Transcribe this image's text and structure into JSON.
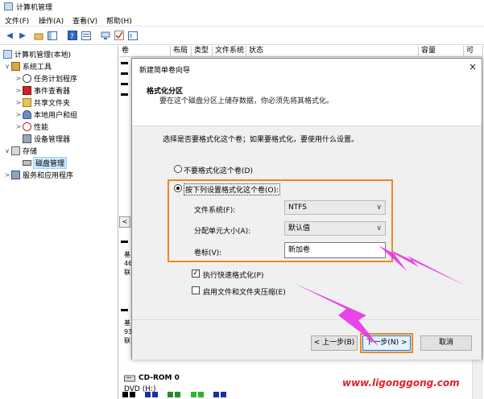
{
  "window": {
    "title": "计算机管理"
  },
  "menu": [
    "文件(F)",
    "操作(A)",
    "查看(V)",
    "帮助(H)"
  ],
  "tree": [
    {
      "label": "计算机管理(本地)",
      "level": 0,
      "arrow": ""
    },
    {
      "label": "系统工具",
      "level": 1,
      "arrow": "∨"
    },
    {
      "label": "任务计划程序",
      "level": 2,
      "arrow": ">"
    },
    {
      "label": "事件查看器",
      "level": 2,
      "arrow": ">"
    },
    {
      "label": "共享文件夹",
      "level": 2,
      "arrow": ">"
    },
    {
      "label": "本地用户和组",
      "level": 2,
      "arrow": ">"
    },
    {
      "label": "性能",
      "level": 2,
      "arrow": ">"
    },
    {
      "label": "设备管理器",
      "level": 2,
      "arrow": ""
    },
    {
      "label": "存储",
      "level": 1,
      "arrow": "∨"
    },
    {
      "label": "磁盘管理",
      "level": 2,
      "arrow": "",
      "selected": true
    },
    {
      "label": "服务和应用程序",
      "level": 1,
      "arrow": ">"
    }
  ],
  "columns": [
    "卷",
    "布局",
    "类型",
    "文件系统",
    "状态",
    "容量",
    "可"
  ],
  "disk_rows": {
    "disk1": [
      "基",
      "46",
      "联"
    ],
    "disk2": [
      "基",
      "93",
      "联"
    ]
  },
  "cdrom": {
    "name": "CD-ROM 0",
    "sub": "DVD (H:)"
  },
  "dialog": {
    "title": "新建简单卷向导",
    "close": "×",
    "heading": "格式化分区",
    "description": "要在这个磁盘分区上储存数据，你必须先将其格式化。",
    "prompt": "选择是否要格式化这个卷；如果要格式化，要使用什么设置。",
    "option_no_format": "不要格式化这个卷(D)",
    "option_format": "按下列设置格式化这个卷(O):",
    "fs_label": "文件系统(F):",
    "fs_value": "NTFS",
    "alloc_label": "分配单元大小(A):",
    "alloc_value": "默认值",
    "volume_label": "卷标(V):",
    "volume_value": "新加卷",
    "quick_format": "执行快速格式化(P)",
    "compression": "启用文件和文件夹压缩(E)",
    "back_button": "< 上一步(B)",
    "next_button": "下一步(N) >",
    "cancel_button": "取消"
  },
  "watermark": "www.ligonggong.com",
  "colors": {
    "highlight": "#f0871e",
    "arrow": "#e632e6",
    "watermark": "#e0202a"
  }
}
